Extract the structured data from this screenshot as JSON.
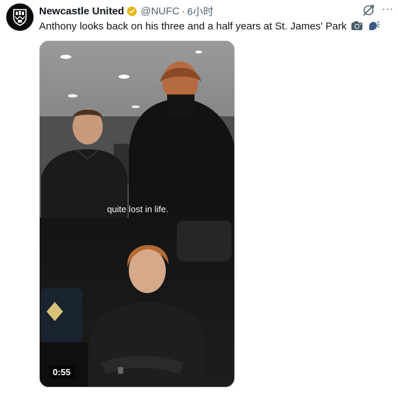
{
  "account": {
    "display_name": "Newcastle United",
    "handle": "@NUFC",
    "separator": "·",
    "time": "6小时",
    "avatar_icon": "newcastle-crest-icon",
    "verified_icon": "verified-gold-badge-icon",
    "verified_color": "#e2b719"
  },
  "actions": {
    "grok_icon": "grok-icon",
    "more_label": "···"
  },
  "tweet": {
    "text": "Anthony looks back on his three and a half years at St. James' Park",
    "emojis": [
      "camera-emoji",
      "speaking-head-emoji"
    ]
  },
  "video": {
    "caption": "quite lost in life.",
    "duration": "0:55"
  },
  "colors": {
    "text_primary": "#0f1419",
    "text_secondary": "#536471",
    "border": "#cfd9de"
  }
}
